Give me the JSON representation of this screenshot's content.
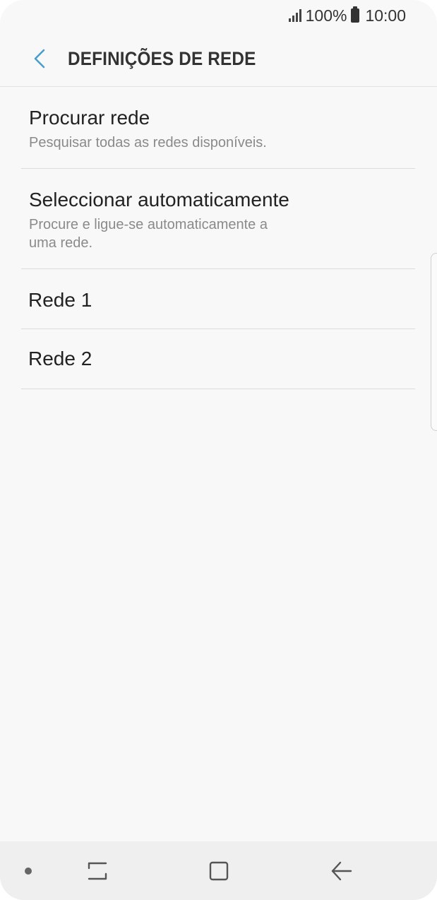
{
  "status_bar": {
    "battery": "100%",
    "time": "10:00"
  },
  "app_bar": {
    "title": "DEFINIÇÕES DE REDE",
    "back_icon": "chevron-left-icon"
  },
  "list": {
    "items": [
      {
        "title": "Procurar rede",
        "subtitle": "Pesquisar todas as redes disponíveis."
      },
      {
        "title": "Seleccionar automaticamente",
        "subtitle": "Procure e ligue-se automaticamente a uma rede."
      },
      {
        "title": "Rede 1"
      },
      {
        "title": "Rede 2"
      }
    ]
  },
  "nav_bar": {
    "icons": [
      "recents-icon",
      "home-icon",
      "back-icon"
    ]
  },
  "colors": {
    "accent": "#4a9ec7",
    "background": "#f8f8f8",
    "nav_background": "#efefef",
    "text_primary": "#222222",
    "text_secondary": "#8a8a8a"
  }
}
